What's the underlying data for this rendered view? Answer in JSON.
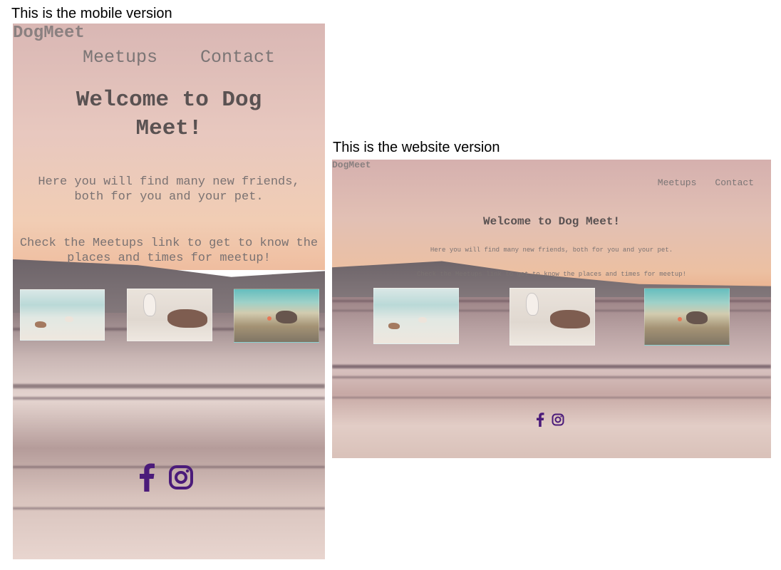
{
  "captions": {
    "mobile": "This is the mobile version",
    "website": "This is the website version"
  },
  "site": {
    "logo": "DogMeet",
    "nav": [
      "Meetups",
      "Contact"
    ],
    "heading": "Welcome to Dog Meet!",
    "intro": "Here you will find many new friends, both for you and your pet.",
    "cta": "Check the Meetups link to get to know the places and times for meetup!",
    "gallery": [
      {
        "icon": "beach-dogs-photo"
      },
      {
        "icon": "dogs-playing-photo"
      },
      {
        "icon": "dog-with-ball-photo"
      }
    ],
    "social": [
      {
        "icon": "facebook-icon"
      },
      {
        "icon": "instagram-icon"
      }
    ],
    "colors": {
      "social_icon": "#4b1b7a",
      "heading": "#5a5252",
      "text": "#7a7272"
    }
  }
}
